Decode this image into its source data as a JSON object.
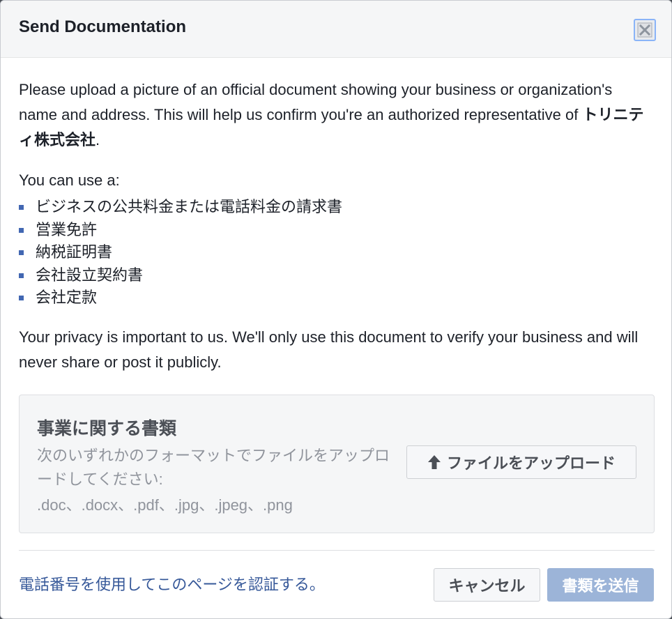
{
  "dialog": {
    "title": "Send Documentation",
    "close_icon": "close-icon"
  },
  "intro": {
    "text_before": "Please upload a picture of an official document showing your business or organization's name and address. This will help us confirm you're an authorized representative of ",
    "company_name": "トリニティ株式会社",
    "text_after": "."
  },
  "use_label": "You can use a:",
  "documents": [
    "ビジネスの公共料金または電話料金の請求書",
    "営業免許",
    "納税証明書",
    "会社設立契約書",
    "会社定款"
  ],
  "privacy_text": "Your privacy is important to us. We'll only use this document to verify your business and will never share or post it publicly.",
  "upload": {
    "title": "事業に関する書類",
    "description": "次のいずれかのフォーマットでファイルをアップロードしてください:",
    "formats": ".doc、.docx、.pdf、.jpg、.jpeg、.png",
    "button_label": "ファイルをアップロード",
    "button_icon": "upload-arrow-icon"
  },
  "footer": {
    "phone_link": "電話番号を使用してこのページを認証する。",
    "cancel_label": "キャンセル",
    "send_label": "書類を送信"
  },
  "colors": {
    "link": "#365899",
    "bullet": "#4267b2",
    "send_disabled": "#9cb4d8"
  }
}
